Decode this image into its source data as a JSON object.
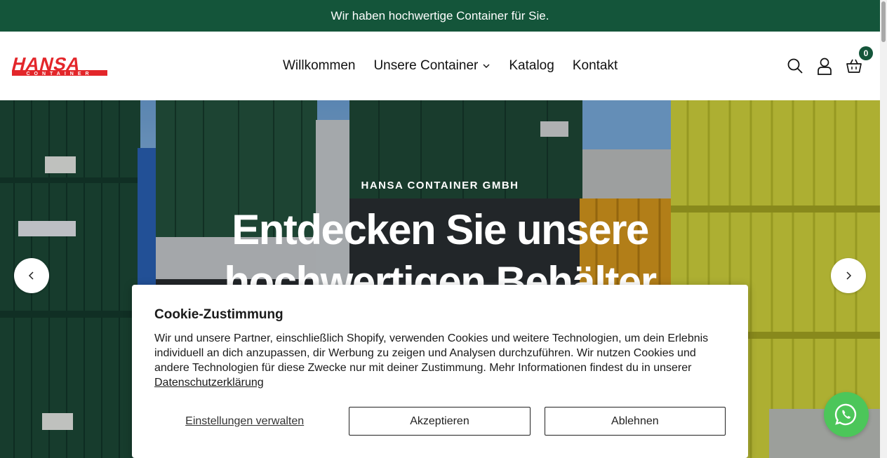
{
  "announcement": {
    "text": "Wir haben hochwertige Container für Sie."
  },
  "header": {
    "logo_text": "HANSA",
    "logo_subtext": "CONTAINER",
    "nav": [
      {
        "label": "Willkommen"
      },
      {
        "label": "Unsere Container",
        "has_dropdown": true
      },
      {
        "label": "Katalog"
      },
      {
        "label": "Kontakt"
      }
    ],
    "icons": [
      "search-icon",
      "account-icon",
      "cart-icon"
    ],
    "cart_count": "0"
  },
  "hero": {
    "kicker": "HANSA CONTAINER GMBH",
    "title_line1": "Entdecken Sie unsere",
    "title_line2": "hochwertigen Behälter"
  },
  "cookie": {
    "title": "Cookie-Zustimmung",
    "text": "Wir und unsere Partner, einschließlich Shopify, verwenden Cookies und weitere Technologien, um dein Erlebnis individuell an dich anzupassen, dir Werbung zu zeigen und Analysen durchzuführen. Wir nutzen Cookies und andere Technologien für diese Zwecke nur mit deiner Zustimmung. Mehr Informationen findest du in unserer",
    "link": "Datenschutzerklärung",
    "manage": "Einstellungen verwalten",
    "accept": "Akzeptieren",
    "decline": "Ablehnen"
  },
  "colors": {
    "brand_green": "#14553a",
    "logo_red": "#e3262a",
    "whatsapp_green": "#4cc65a"
  }
}
